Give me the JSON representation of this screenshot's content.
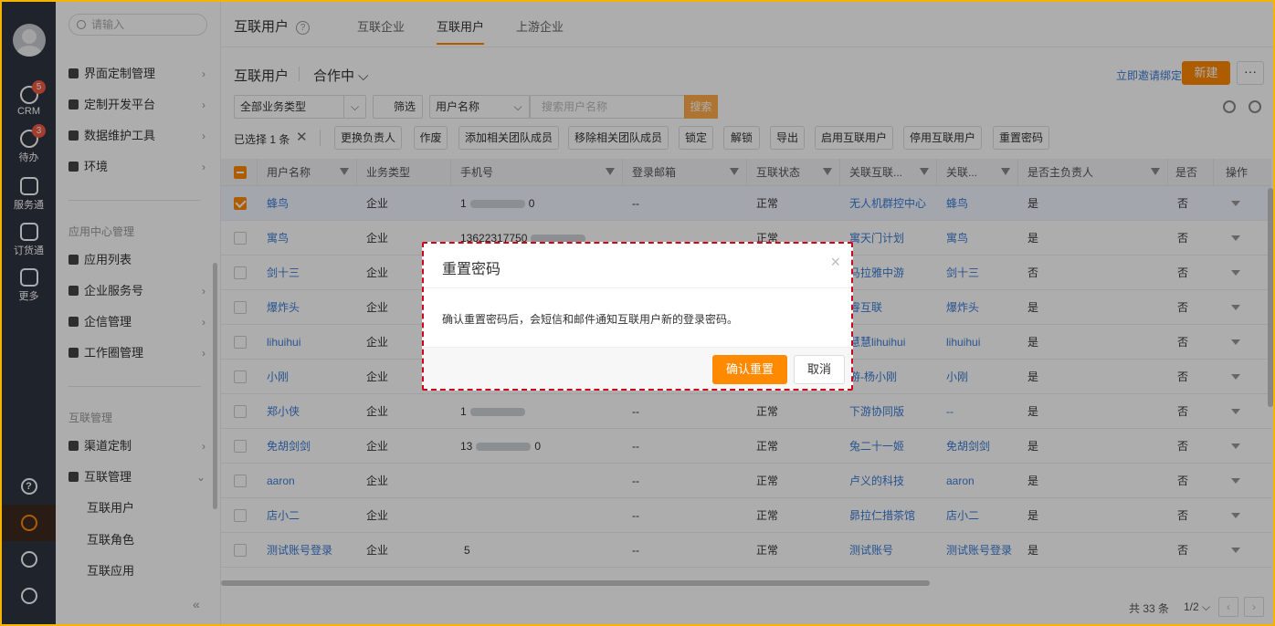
{
  "rail": {
    "items": [
      {
        "label": "CRM",
        "badge": "5"
      },
      {
        "label": "待办",
        "badge": "3"
      },
      {
        "label": "服务通"
      },
      {
        "label": "订货通"
      },
      {
        "label": "更多"
      }
    ],
    "bottom_icons": [
      "help-icon",
      "settings-icon",
      "clock-icon",
      "contacts-icon"
    ],
    "help_glyph": "?"
  },
  "sidebar": {
    "search_placeholder": "请输入",
    "items_top": [
      {
        "label": "界面定制管理"
      },
      {
        "label": "定制开发平台"
      },
      {
        "label": "数据维护工具"
      },
      {
        "label": "环境"
      }
    ],
    "group1": "应用中心管理",
    "items_group1": [
      {
        "label": "应用列表"
      },
      {
        "label": "企业服务号"
      },
      {
        "label": "企信管理"
      },
      {
        "label": "工作圈管理"
      }
    ],
    "group2": "互联管理",
    "items_group2": [
      {
        "label": "渠道定制"
      },
      {
        "label": "互联管理"
      }
    ],
    "sub_items": [
      {
        "label": "互联用户"
      },
      {
        "label": "互联角色"
      },
      {
        "label": "互联应用"
      }
    ],
    "arrow": "›",
    "arrow_down": "⌄",
    "collapse": "«"
  },
  "header": {
    "title": "互联用户",
    "help": "?",
    "tabs": [
      "互联企业",
      "互联用户",
      "上游企业"
    ]
  },
  "view": {
    "title": "互联用户",
    "filter": "合作中 ⌵",
    "invite_link": "立即邀请绑定",
    "new_button": "新建",
    "more_button": "···"
  },
  "filters": {
    "biz_type": "全部业务类型",
    "filter_button": "筛选",
    "field": "用户名称",
    "search_placeholder": "搜索用户名称",
    "search_button": "搜索",
    "caret": "⌵"
  },
  "actions": {
    "selected_text": "已选择 1 条",
    "clear": "✕",
    "buttons": [
      "更换负责人",
      "作废",
      "添加相关团队成员",
      "移除相关团队成员",
      "锁定",
      "解锁",
      "导出",
      "启用互联用户",
      "停用互联用户",
      "重置密码"
    ]
  },
  "table": {
    "columns": [
      "用户名称",
      "业务类型",
      "手机号",
      "登录邮箱",
      "互联状态",
      "关联互联...",
      "关联...",
      "是否主负责人",
      "是否管...",
      "操作"
    ],
    "rows": [
      {
        "name": "蜂鸟",
        "type": "企业",
        "phone": "1",
        "phone_tail": "0",
        "email": "--",
        "status": "正常",
        "org": "无人机群控中心",
        "contact": "蜂鸟",
        "primary": "是",
        "admin": "否",
        "selected": true
      },
      {
        "name": "寓鸟",
        "type": "企业",
        "phone": "13622317750",
        "phone_tail": "",
        "email": "",
        "status": "正常",
        "org": "寓天门计划",
        "contact": "寓鸟",
        "primary": "是",
        "admin": "否",
        "selected": false
      },
      {
        "name": "剑十三",
        "type": "企业",
        "phone": "",
        "phone_tail": "",
        "email": "",
        "status": "",
        "org": "马拉雅中游",
        "contact": "剑十三",
        "primary": "否",
        "admin": "否",
        "selected": false
      },
      {
        "name": "爆炸头",
        "type": "企业",
        "phone": "",
        "phone_tail": "",
        "email": "",
        "status": "",
        "org": "睿互联",
        "contact": "爆炸头",
        "primary": "是",
        "admin": "否",
        "selected": false
      },
      {
        "name": "lihuihui",
        "type": "企业",
        "phone": "",
        "phone_tail": "",
        "email": "",
        "status": "",
        "org": "慧慧lihuihui",
        "contact": "lihuihui",
        "primary": "是",
        "admin": "否",
        "selected": false
      },
      {
        "name": "小刚",
        "type": "企业",
        "phone": "",
        "phone_tail": "",
        "email": "",
        "status": "",
        "org": "游-杨小刚",
        "contact": "小刚",
        "primary": "是",
        "admin": "否",
        "selected": false
      },
      {
        "name": "郑小侠",
        "type": "企业",
        "phone": "1",
        "phone_tail": "",
        "email": "--",
        "status": "正常",
        "org": "下游协同版",
        "contact": "--",
        "primary": "是",
        "admin": "否",
        "selected": false
      },
      {
        "name": "免胡剑剑",
        "type": "企业",
        "phone": "13",
        "phone_tail": "0",
        "email": "--",
        "status": "正常",
        "org": "兔二十一姬",
        "contact": "免胡剑剑",
        "primary": "是",
        "admin": "否",
        "selected": false
      },
      {
        "name": "aaron",
        "type": "企业",
        "phone": "",
        "phone_tail": "",
        "email": "--",
        "status": "正常",
        "org": "卢义的科技",
        "contact": "aaron",
        "primary": "是",
        "admin": "否",
        "selected": false
      },
      {
        "name": "店小二",
        "type": "企业",
        "phone": "",
        "phone_tail": "",
        "email": "--",
        "status": "正常",
        "org": "昴拉仁措茶馆",
        "contact": "店小二",
        "primary": "是",
        "admin": "否",
        "selected": false
      },
      {
        "name": "测试账号登录",
        "type": "企业",
        "phone": "",
        "phone_tail": "5",
        "email": "--",
        "status": "正常",
        "org": "测试账号",
        "contact": "测试账号登录",
        "primary": "是",
        "admin": "否",
        "selected": false
      }
    ]
  },
  "pager": {
    "total": "共 33 条",
    "page": "1/2 ⌵",
    "prev": "‹",
    "next": "›"
  },
  "modal": {
    "title": "重置密码",
    "close": "×",
    "body": "确认重置密码后，会短信和邮件通知互联用户新的登录密码。",
    "confirm": "确认重置",
    "cancel": "取消"
  }
}
